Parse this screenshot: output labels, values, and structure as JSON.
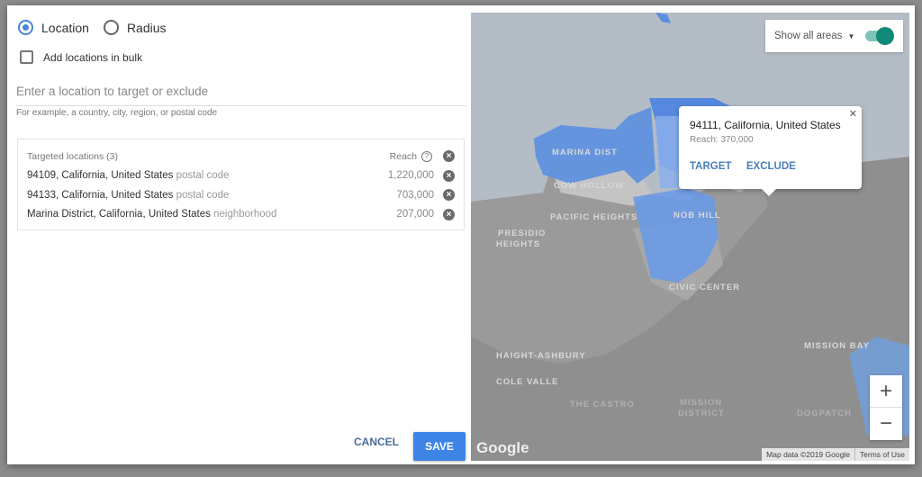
{
  "mode": {
    "options": [
      {
        "label": "Location",
        "selected": true
      },
      {
        "label": "Radius",
        "selected": false
      }
    ]
  },
  "bulk": {
    "label": "Add locations in bulk",
    "checked": false
  },
  "search": {
    "placeholder": "Enter a location to target or exclude",
    "value": "",
    "hint": "For example, a country, city, region, or postal code"
  },
  "targeted": {
    "header": "Targeted locations (3)",
    "reach_label": "Reach",
    "items": [
      {
        "name": "94109, California, United States",
        "type": "postal code",
        "reach": "1,220,000"
      },
      {
        "name": "94133, California, United States",
        "type": "postal code",
        "reach": "703,000"
      },
      {
        "name": "Marina District, California, United States",
        "type": "neighborhood",
        "reach": "207,000"
      }
    ]
  },
  "footer": {
    "cancel": "CANCEL",
    "save": "SAVE"
  },
  "map": {
    "show_areas_label": "Show all areas",
    "show_areas_on": true,
    "popup": {
      "title": "94111, California, United States",
      "reach": "Reach: 370,000",
      "target": "TARGET",
      "exclude": "EXCLUDE"
    },
    "labels": [
      "MARINA DIST",
      "COW HOLLOW",
      "PACIFIC HEIGHTS",
      "PRESIDIO",
      "HEIGHTS",
      "NOB HILL",
      "CIVIC CENTER",
      "HAIGHT-ASHBURY",
      "COLE VALLE",
      "MISSION BAY",
      "THE CASTRO",
      "MISSION",
      "DISTRICT",
      "DOGPATCH"
    ],
    "logo": "Google",
    "attribution": "Map data ©2019 Google",
    "terms": "Terms of Use",
    "accent": "#3d84e6",
    "toggle_color": "#108a76"
  }
}
